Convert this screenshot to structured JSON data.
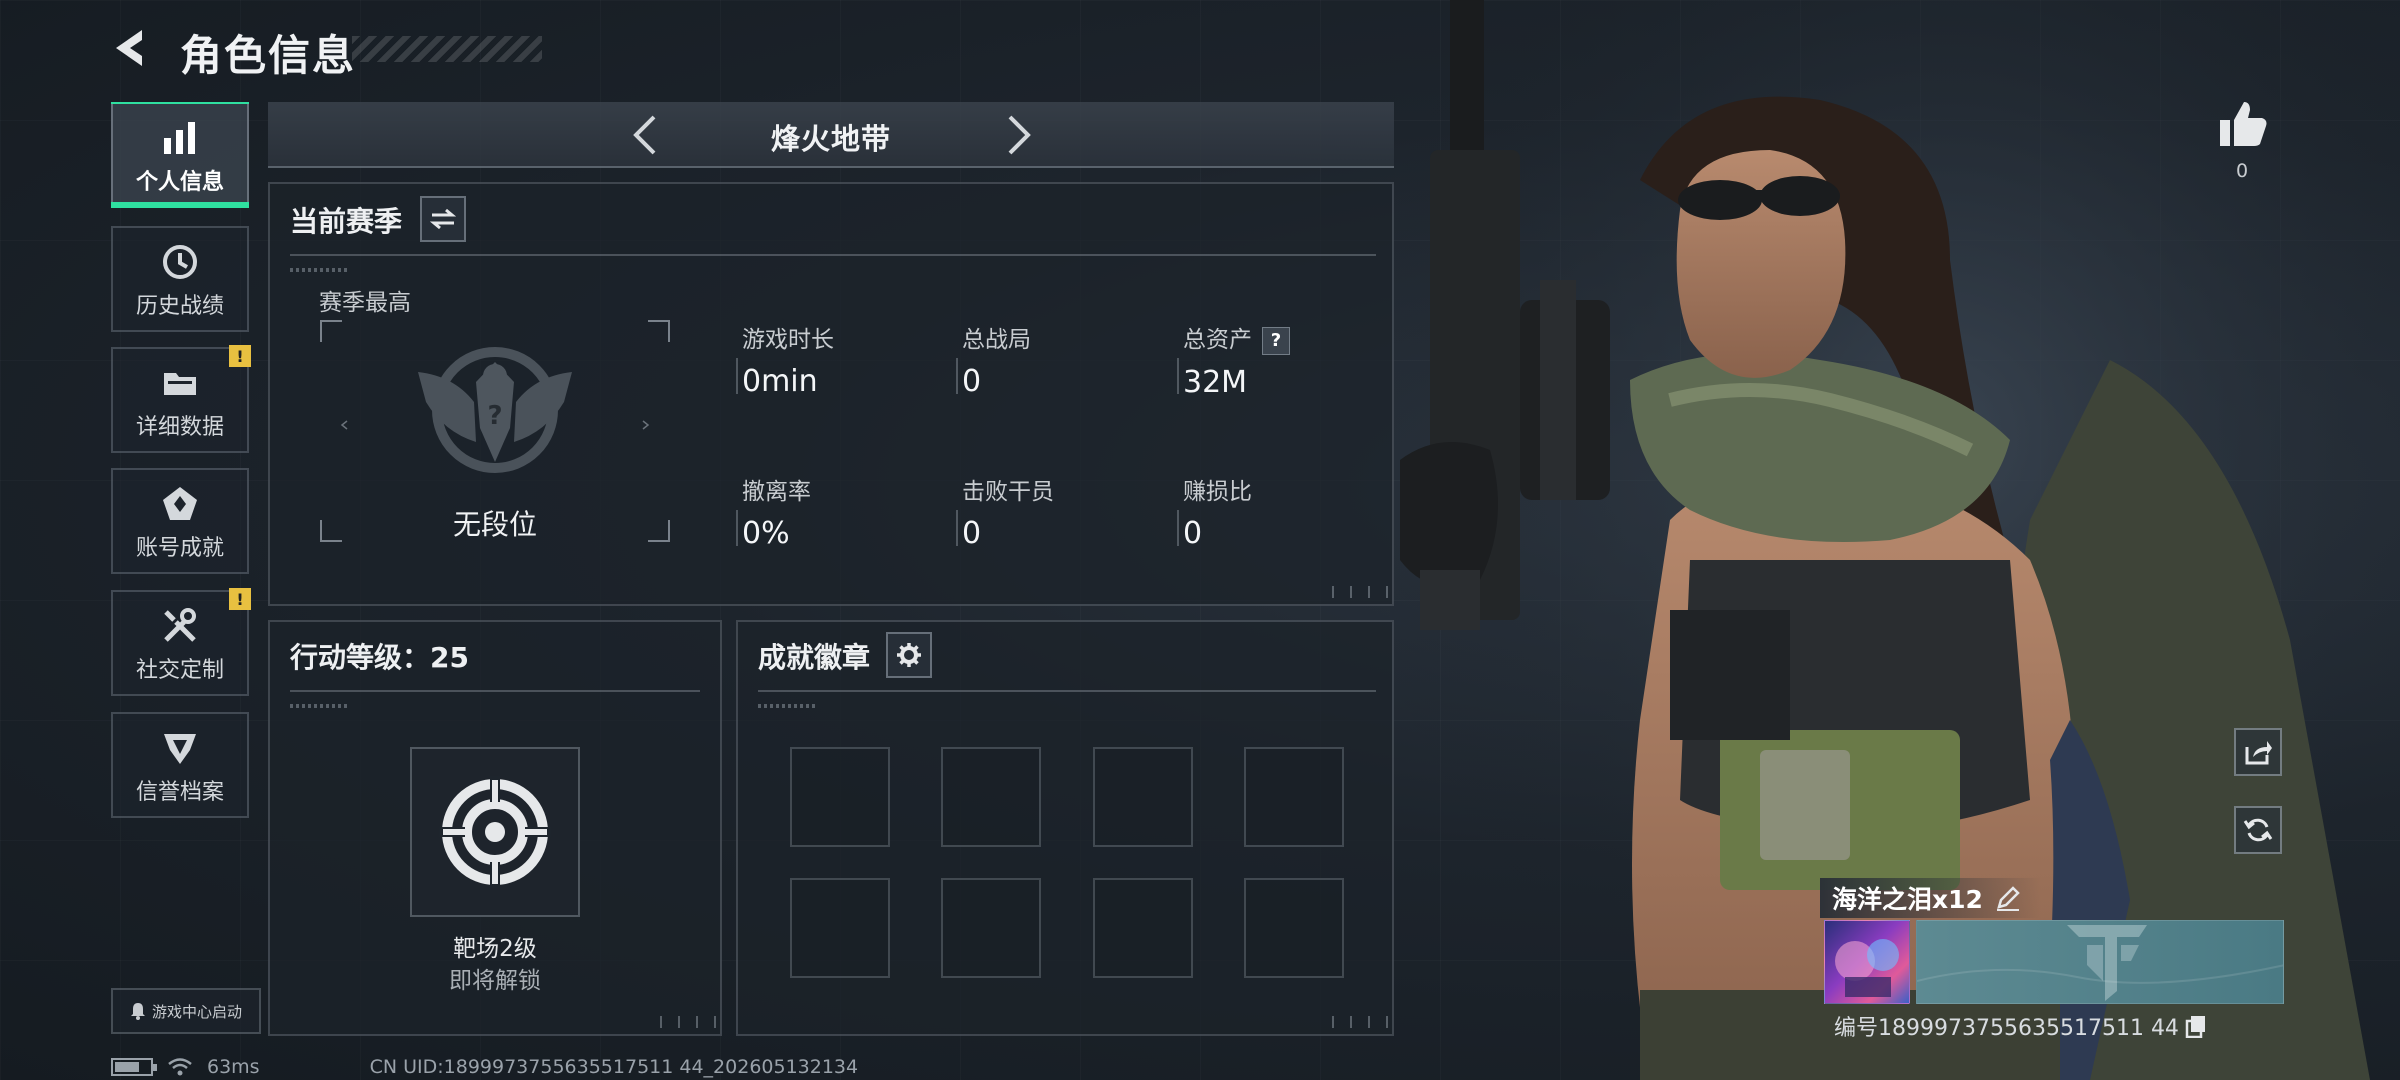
{
  "header": {
    "title": "角色信息"
  },
  "nav": {
    "items": [
      {
        "label": "个人信息",
        "icon": "bar-chart-icon",
        "active": true,
        "alert": false
      },
      {
        "label": "历史战绩",
        "icon": "history-icon",
        "active": false,
        "alert": false
      },
      {
        "label": "详细数据",
        "icon": "folder-icon",
        "active": false,
        "alert": true
      },
      {
        "label": "账号成就",
        "icon": "achievement-icon",
        "active": false,
        "alert": false
      },
      {
        "label": "社交定制",
        "icon": "tools-icon",
        "active": false,
        "alert": true
      },
      {
        "label": "信誉档案",
        "icon": "reputation-icon",
        "active": false,
        "alert": false
      }
    ],
    "alert_mark": "!"
  },
  "mode": {
    "title": "烽火地带"
  },
  "season": {
    "title": "当前赛季",
    "best_label": "赛季最高",
    "rank_name": "无段位",
    "stats": [
      {
        "label": "游戏时长",
        "value": "0min"
      },
      {
        "label": "总战局",
        "value": "0"
      },
      {
        "label": "总资产",
        "value": "32M",
        "help": "?"
      },
      {
        "label": "撤离率",
        "value": "0%"
      },
      {
        "label": "击败干员",
        "value": "0"
      },
      {
        "label": "赚损比",
        "value": "0"
      }
    ]
  },
  "level": {
    "title": "行动等级：25",
    "item_name": "靶场2级",
    "item_status": "即将解锁"
  },
  "badges": {
    "title": "成就徽章",
    "slots": 8
  },
  "player": {
    "likes": "0",
    "name": "海洋之泪x12",
    "id_text": "编号1899973755635517511 44"
  },
  "footer": {
    "game_center": "游戏中心启动",
    "ping": "63ms",
    "uid": "CN UID:1899973755635517511 44_202605132134",
    "battery_level": 0.7
  },
  "colors": {
    "accent": "#2fe0a0",
    "alert": "#e8c040"
  }
}
